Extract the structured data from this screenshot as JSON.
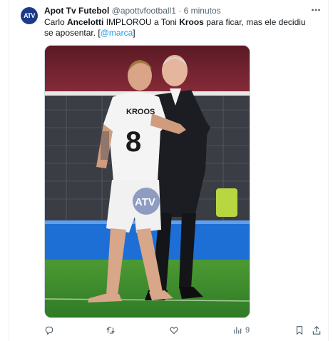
{
  "tweet": {
    "avatar_text": "ATV",
    "author_name": "Apot Tv Futebol",
    "author_handle": "@apottvfootball1",
    "separator": "·",
    "time": "6 minutos",
    "text_parts": [
      "Carlo ",
      "Ancelotti",
      " IMPLOROU a Toni ",
      "Kroos",
      " para ficar, mas ele decidiu se aposentar. [",
      "@marca",
      "]"
    ],
    "image": {
      "jersey_name": "KROOS",
      "jersey_number": "8",
      "watermark": "ATV"
    },
    "actions": {
      "views_count": "9"
    }
  },
  "colors": {
    "link": "#1d9bf0",
    "muted": "#536471",
    "pitch": "#3e8e2f",
    "stands": "#7a2233",
    "ad_board": "#1d6fd6"
  },
  "icons": [
    "more-icon",
    "reply-icon",
    "retweet-icon",
    "like-icon",
    "views-icon",
    "bookmark-icon",
    "share-icon"
  ]
}
